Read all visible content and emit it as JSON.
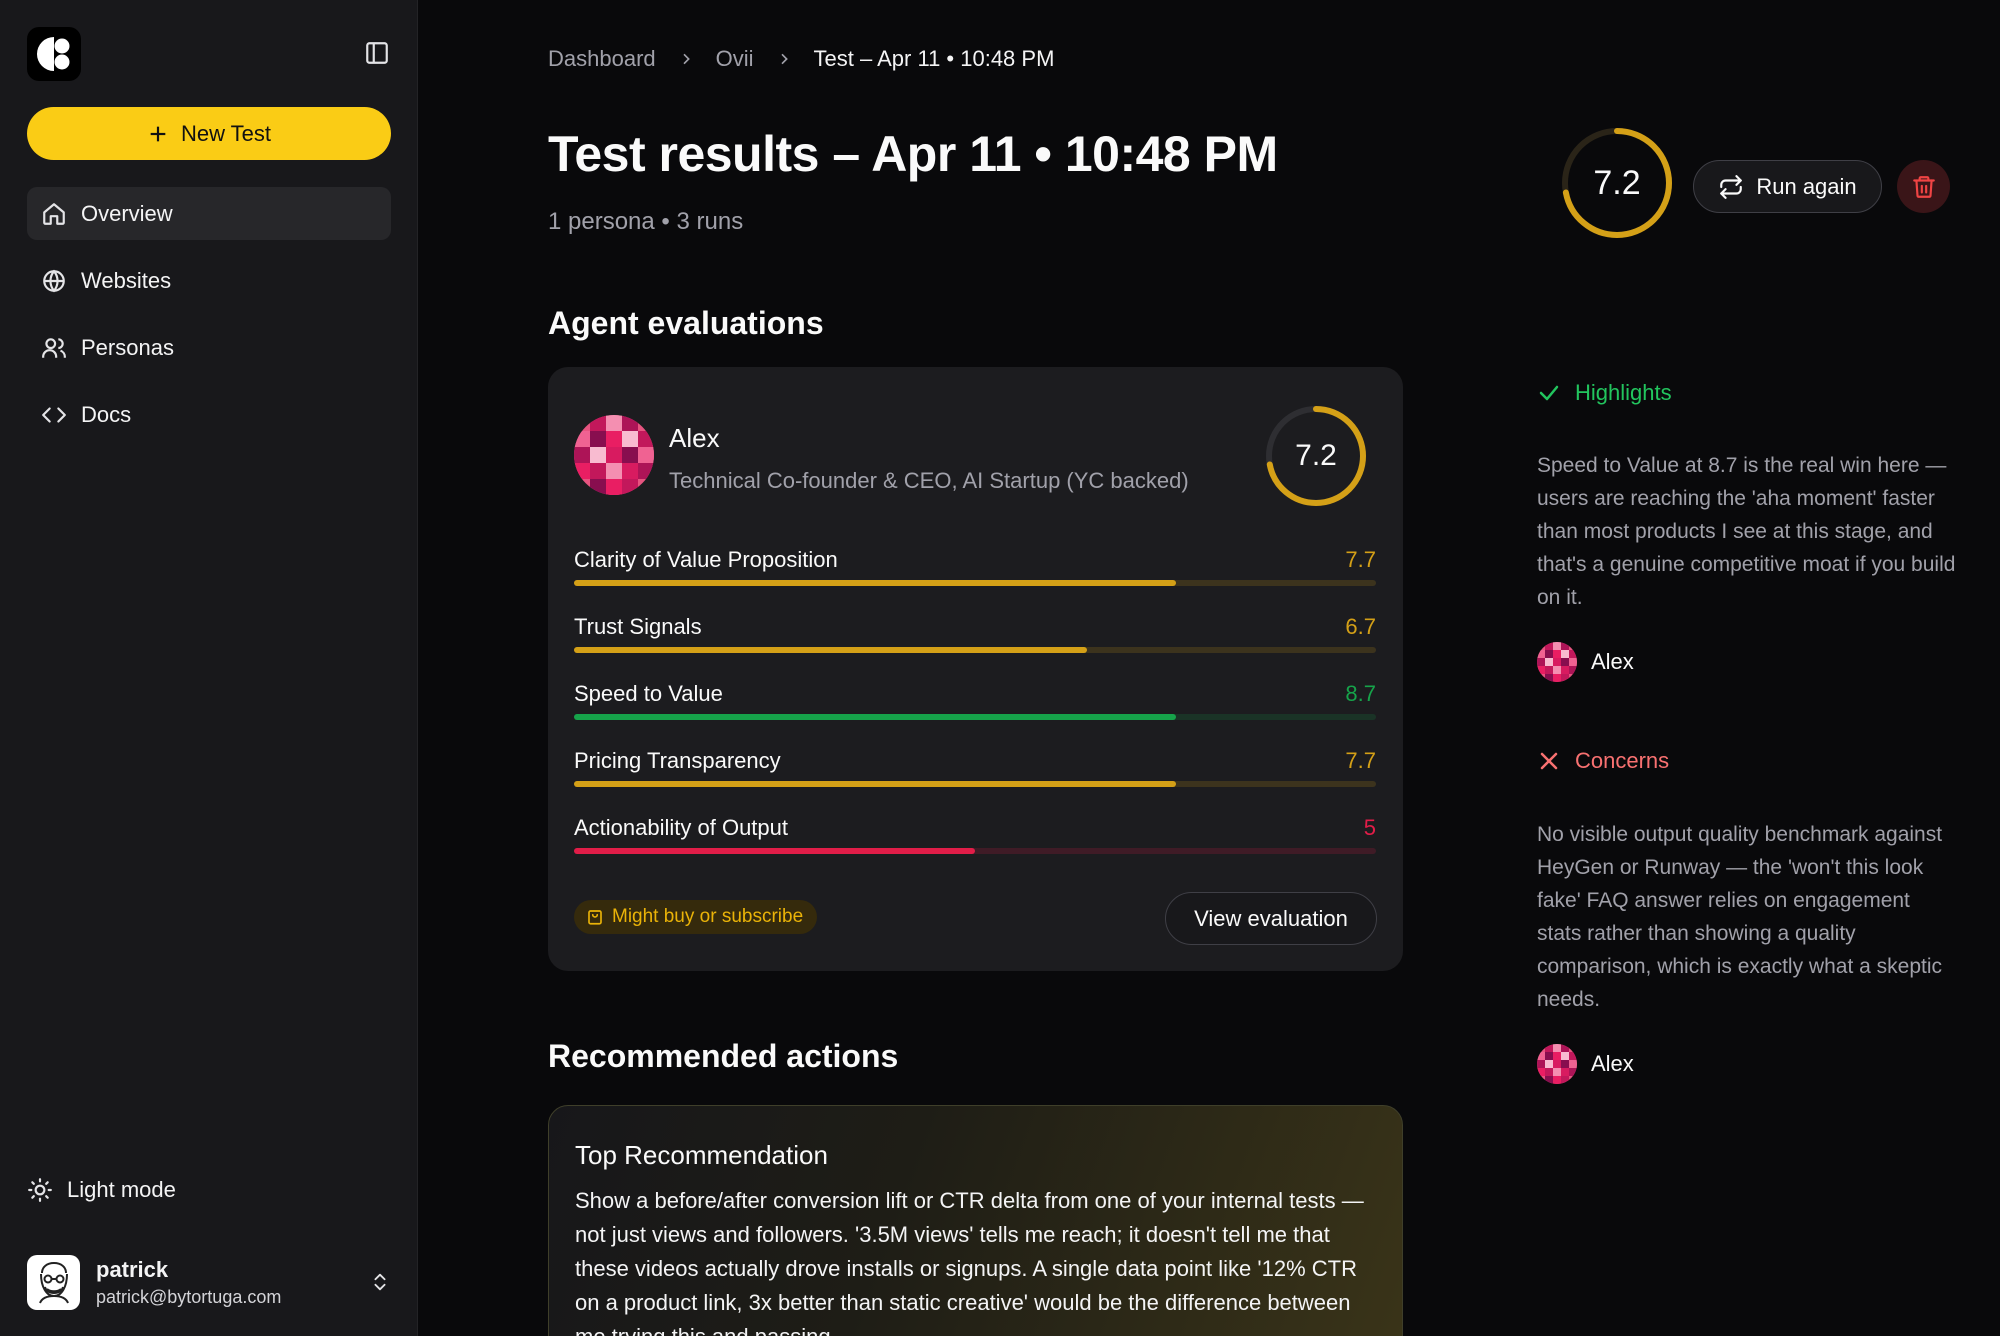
{
  "sidebar": {
    "new_test_label": "New Test",
    "nav": [
      {
        "label": "Overview",
        "icon": "home-icon",
        "active": true
      },
      {
        "label": "Websites",
        "icon": "globe-icon"
      },
      {
        "label": "Personas",
        "icon": "users-icon"
      },
      {
        "label": "Docs",
        "icon": "code-icon"
      }
    ],
    "light_mode_label": "Light mode",
    "user": {
      "name": "patrick",
      "email": "patrick@bytortuga.com"
    }
  },
  "breadcrumb": [
    "Dashboard",
    "Ovii",
    "Test – Apr 11 • 10:48 PM"
  ],
  "header": {
    "title": "Test results – Apr 11 • 10:48 PM",
    "subtitle": "1 persona • 3 runs",
    "overall_score": "7.2",
    "overall_score_fraction": 0.72,
    "run_again_label": "Run again"
  },
  "agent_evaluations": {
    "section_title": "Agent evaluations",
    "card": {
      "persona_name": "Alex",
      "persona_role": "Technical Co-founder & CEO, AI Startup (YC backed)",
      "score": "7.2",
      "score_fraction": 0.72,
      "metrics": [
        {
          "label": "Clarity of Value Proposition",
          "value": "7.7",
          "fraction": 0.75,
          "color": "#d4a017"
        },
        {
          "label": "Trust Signals",
          "value": "6.7",
          "fraction": 0.64,
          "color": "#d4a017"
        },
        {
          "label": "Speed to Value",
          "value": "8.7",
          "fraction": 0.75,
          "color": "#16a34a"
        },
        {
          "label": "Pricing Transparency",
          "value": "7.7",
          "fraction": 0.75,
          "color": "#d4a017"
        },
        {
          "label": "Actionability of Output",
          "value": "5",
          "fraction": 0.5,
          "color": "#e11d48"
        }
      ],
      "intent_label": "Might buy or subscribe",
      "view_label": "View evaluation"
    }
  },
  "recommended": {
    "section_title": "Recommended actions",
    "card_title": "Top Recommendation",
    "card_body": "Show a before/after conversion lift or CTR delta from one of your internal tests — not just views and followers. '3.5M views' tells me reach; it doesn't tell me that these videos actually drove installs or signups. A single data point like '12% CTR on a product link, 3x better than static creative' would be the difference between me trying this and passing."
  },
  "highlights": {
    "title": "Highlights",
    "text": "Speed to Value at 8.7 is the real win here — users are reaching the 'aha moment' faster than most products I see at this stage, and that's a genuine competitive moat if you build on it.",
    "author": "Alex",
    "color": "#22c55e"
  },
  "concerns": {
    "title": "Concerns",
    "text": "No visible output quality benchmark against HeyGen or Runway — the 'won't this look fake' FAQ answer relies on engagement stats rather than showing a quality comparison, which is exactly what a skeptic needs.",
    "author": "Alex",
    "color": "#f87171"
  },
  "colors": {
    "accent": "#facc15",
    "ring": "#d4a017",
    "background": "#09090b",
    "sidebar": "#18181b"
  }
}
